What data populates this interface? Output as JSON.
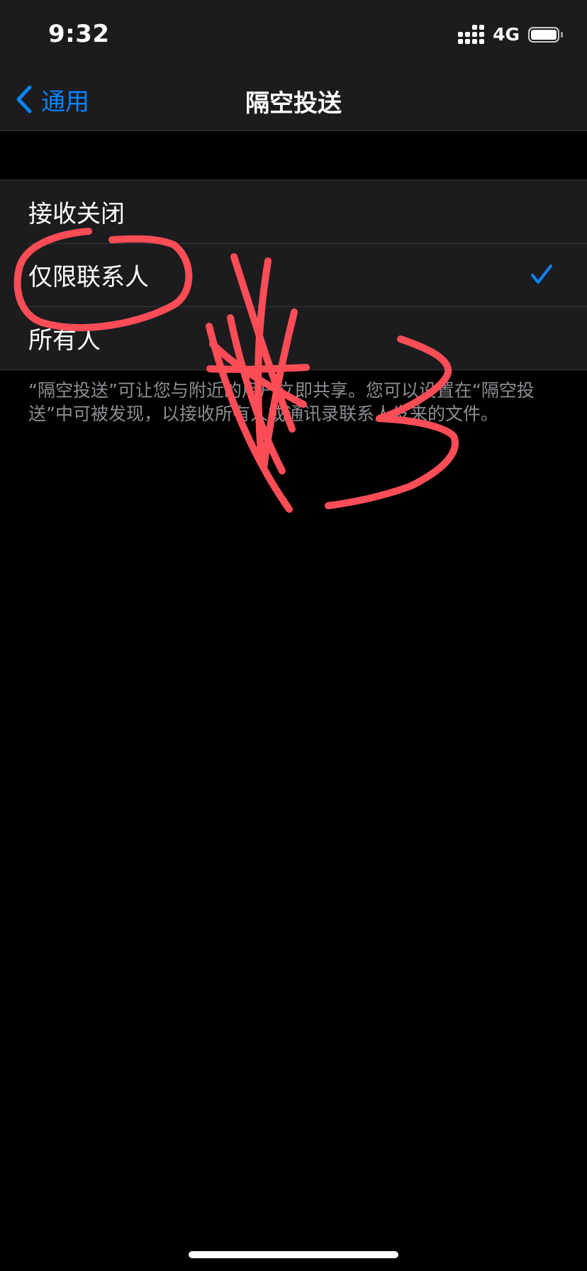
{
  "status_bar": {
    "time": "9:32",
    "network": "4G",
    "icons": [
      "signal-icon",
      "battery-icon"
    ]
  },
  "nav": {
    "back_label": "通用",
    "title": "隔空投送",
    "back_icon": "chevron-left-icon"
  },
  "options": [
    {
      "label": "接收关闭",
      "selected": false
    },
    {
      "label": "仅限联系人",
      "selected": true
    },
    {
      "label": "所有人",
      "selected": false
    }
  ],
  "footer_note": "“隔空投送”可让您与附近的用户立即共享。您可以设置在“隔空投送”中可被发现，以接收所有人或通讯录联系人发来的文件。",
  "colors": {
    "accent": "#0a84ff",
    "background": "#000000",
    "group_background": "#1c1c1e",
    "separator": "#38383a",
    "secondary_text": "#8d8d93",
    "annotation": "#ff4d57"
  },
  "annotation": {
    "description_icon": "hand-drawn-markup",
    "text": "#3"
  }
}
